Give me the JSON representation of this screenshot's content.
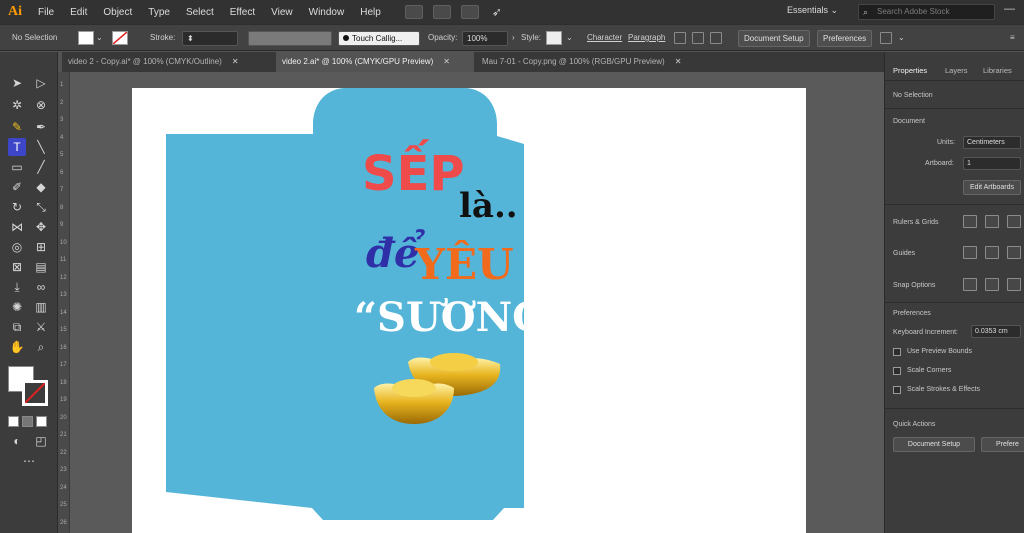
{
  "app": {
    "logo": "Ai",
    "menus": [
      "File",
      "Edit",
      "Object",
      "Type",
      "Select",
      "Effect",
      "View",
      "Window",
      "Help"
    ],
    "workspace": "Essentials",
    "search_placeholder": "Search Adobe Stock"
  },
  "control_bar": {
    "selection": "No Selection",
    "stroke_label": "Stroke:",
    "brush": "Touch Callig...",
    "opacity_label": "Opacity:",
    "opacity_value": "100%",
    "style_label": "Style:",
    "character_label": "Character",
    "paragraph_label": "Paragraph",
    "document_setup": "Document Setup",
    "preferences": "Preferences"
  },
  "tabs": [
    {
      "label": "video 2 - Copy.ai* @ 100% (CMYK/Outline)",
      "active": false
    },
    {
      "label": "video 2.ai* @ 100% (CMYK/GPU Preview)",
      "active": true
    },
    {
      "label": "Mau 7-01 - Copy.png @ 100% (RGB/GPU Preview)",
      "active": false
    }
  ],
  "artwork": {
    "line1": "SẾP",
    "line2": "là..",
    "line3a": "để",
    "line3b": "YÊU",
    "line4": "“SƯƠNG”",
    "colors": {
      "envelope": "#55b5d8",
      "red": "#ef4b4b",
      "orange": "#f26a1b",
      "blue": "#2f2fa8",
      "black": "#111111",
      "white": "#ffffff"
    }
  },
  "ruler_ticks": [
    "1",
    "2",
    "3",
    "4",
    "5",
    "6",
    "7",
    "8",
    "9",
    "10",
    "11",
    "12",
    "13",
    "14",
    "15",
    "16",
    "17",
    "18",
    "19",
    "20",
    "21",
    "22",
    "23",
    "24",
    "25",
    "26"
  ],
  "panel": {
    "tabs": [
      "Properties",
      "Layers",
      "Libraries"
    ],
    "no_selection": "No Selection",
    "document_label": "Document",
    "units_label": "Units:",
    "units_value": "Centimeters",
    "artboard_label": "Artboard:",
    "artboard_value": "1",
    "edit_artboards": "Edit Artboards",
    "rulers_grids": "Rulers & Grids",
    "guides": "Guides",
    "snap_options": "Snap Options",
    "preferences": "Preferences",
    "keyboard_increment_label": "Keyboard Increment:",
    "keyboard_increment_value": "0.0353 cm",
    "checkboxes": [
      "Use Preview Bounds",
      "Scale Corners",
      "Scale Strokes & Effects"
    ],
    "quick_actions": "Quick Actions",
    "qa_document_setup": "Document Setup",
    "qa_preferences": "Prefere"
  }
}
